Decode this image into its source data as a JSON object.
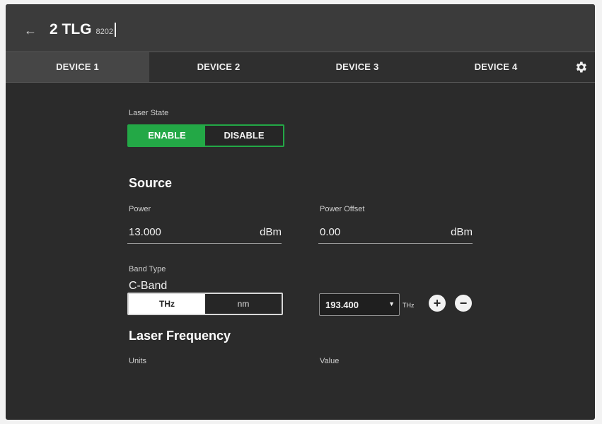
{
  "header": {
    "back_icon": "arrow-left-icon",
    "title": "2 TLG",
    "subtitle": "8202"
  },
  "tabs": [
    {
      "label": "DEVICE 1",
      "active": true
    },
    {
      "label": "DEVICE 2",
      "active": false
    },
    {
      "label": "DEVICE 3",
      "active": false
    },
    {
      "label": "DEVICE 4",
      "active": false
    }
  ],
  "settings_icon": "gear-icon",
  "laser_state": {
    "label": "Laser State",
    "options": [
      "ENABLE",
      "DISABLE"
    ],
    "selected": "ENABLE",
    "active_color": "#23a846"
  },
  "source": {
    "heading": "Source",
    "power": {
      "label": "Power",
      "value": "13.000",
      "unit": "dBm"
    },
    "power_offset": {
      "label": "Power Offset",
      "value": "0.00",
      "unit": "dBm"
    },
    "band_type": {
      "label": "Band Type",
      "value": "C-Band"
    }
  },
  "laser_frequency": {
    "heading": "Laser Frequency",
    "units_label": "Units",
    "units_options": [
      "THz",
      "nm"
    ],
    "units_selected": "THz",
    "value_label": "Value",
    "value": "193.400",
    "value_unit": "THz",
    "increment_icon": "plus-circle-icon",
    "decrement_icon": "minus-circle-icon"
  }
}
